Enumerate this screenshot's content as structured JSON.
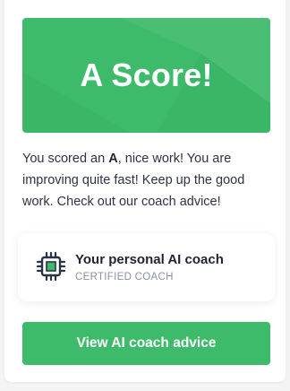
{
  "hero": {
    "title": "A Score!",
    "color": "#3dbb6a"
  },
  "message": {
    "prefix": "You scored an ",
    "grade": "A",
    "suffix": ", nice work! You are improving quite fast! Keep up the good work. Check out our coach advice!"
  },
  "coach": {
    "icon": "cpu-chip-icon",
    "title": "Your personal AI coach",
    "subtitle": "CERTIFIED COACH",
    "icon_accent": "#3dbb6a",
    "icon_color": "#2d3344"
  },
  "cta": {
    "label": "View AI coach advice",
    "color": "#3dbb6a"
  }
}
